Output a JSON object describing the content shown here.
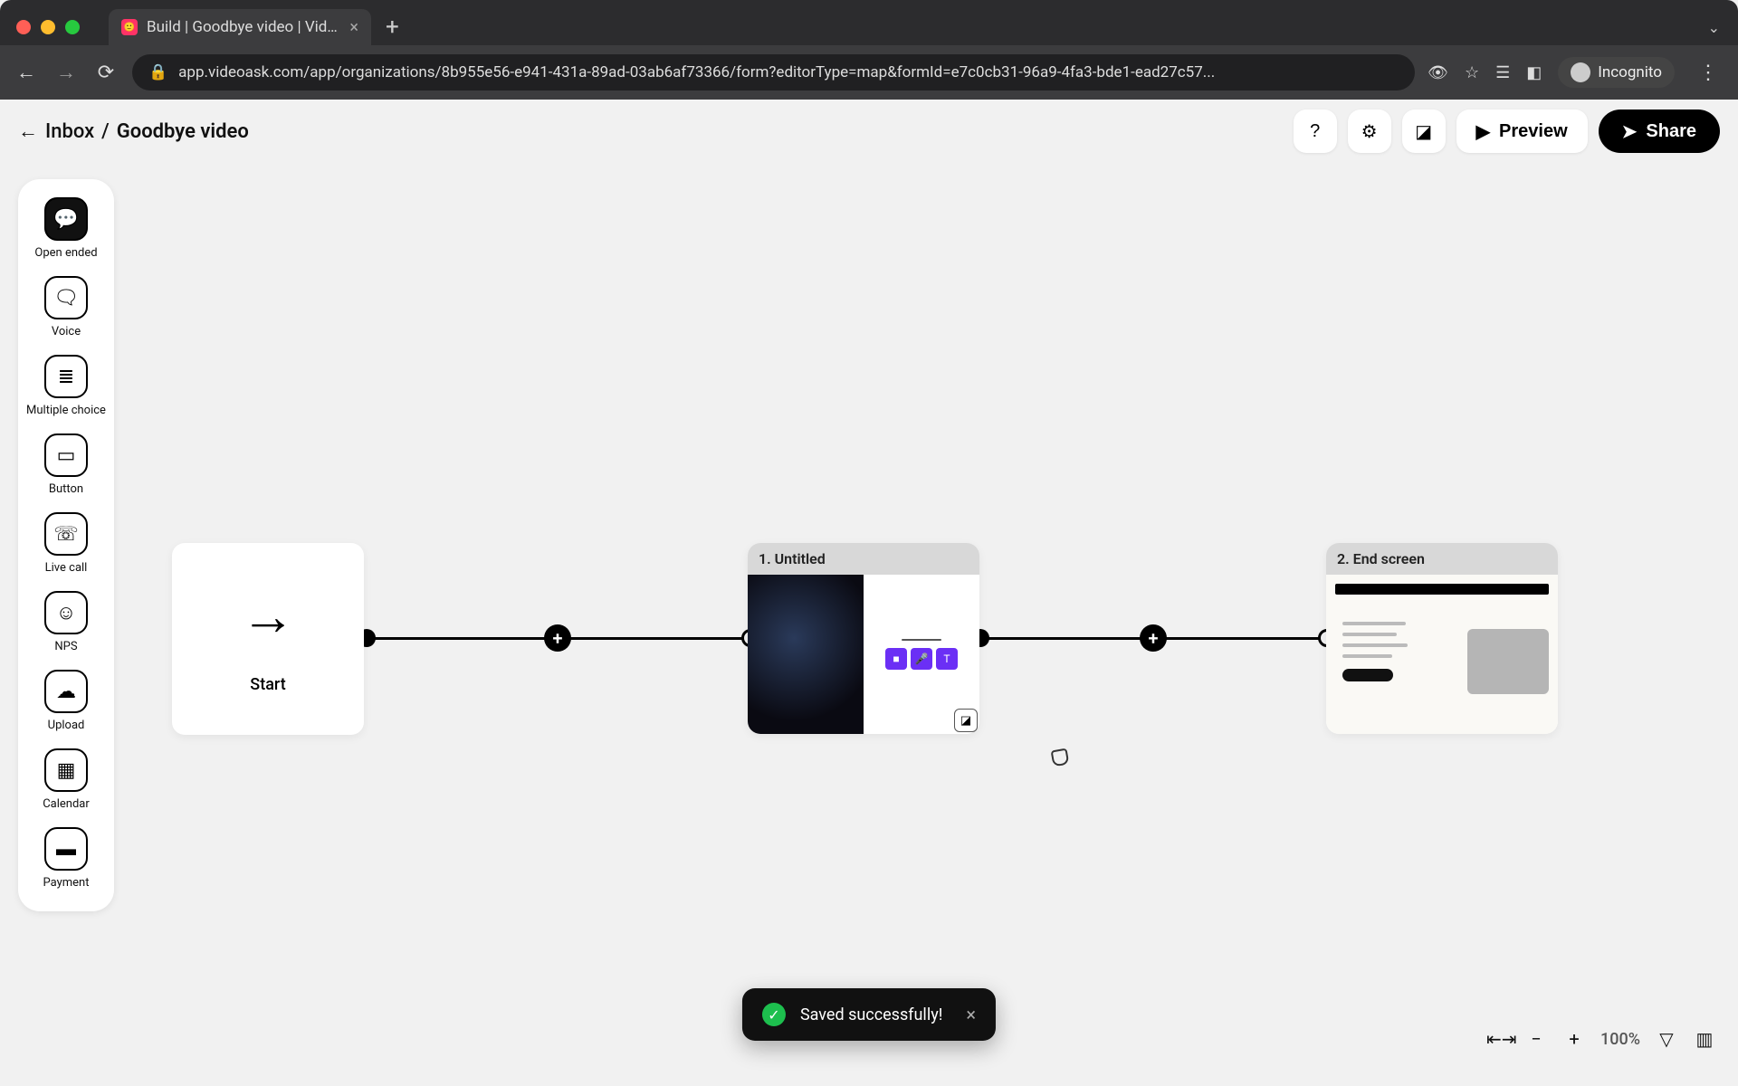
{
  "browser": {
    "tab_title": "Build | Goodbye video | VideoA",
    "url": "app.videoask.com/app/organizations/8b955e56-e941-431a-89ad-03ab6af73366/form?editorType=map&formId=e7c0cb31-96a9-4fa3-bde1-ead27c57...",
    "incognito_label": "Incognito"
  },
  "header": {
    "back_label": "Inbox",
    "separator": "/",
    "page_title": "Goodbye video",
    "preview_label": "Preview",
    "share_label": "Share"
  },
  "toolbox": [
    {
      "id": "open-ended",
      "label": "Open ended"
    },
    {
      "id": "voice",
      "label": "Voice"
    },
    {
      "id": "multiple-choice",
      "label": "Multiple choice"
    },
    {
      "id": "button",
      "label": "Button"
    },
    {
      "id": "live-call",
      "label": "Live call"
    },
    {
      "id": "nps",
      "label": "NPS"
    },
    {
      "id": "upload",
      "label": "Upload"
    },
    {
      "id": "calendar",
      "label": "Calendar"
    },
    {
      "id": "payment",
      "label": "Payment"
    }
  ],
  "nodes": {
    "start": {
      "label": "Start"
    },
    "step1": {
      "title": "1. Untitled"
    },
    "end": {
      "title": "2. End screen"
    }
  },
  "toast": {
    "message": "Saved successfully!"
  },
  "zoom": {
    "percent": "100%"
  }
}
